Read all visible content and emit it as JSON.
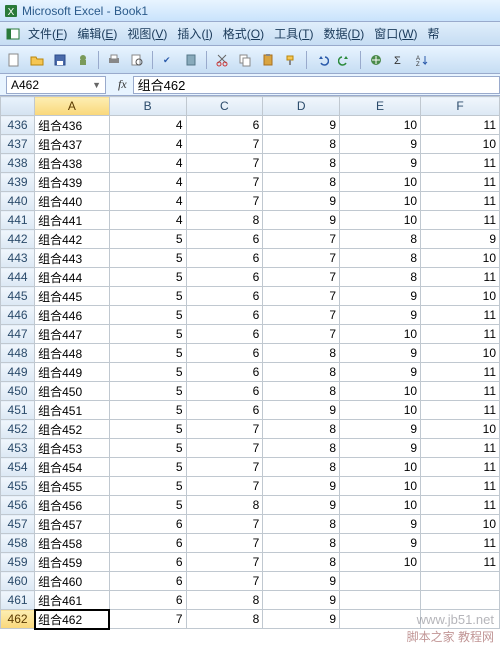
{
  "title": "Microsoft Excel - Book1",
  "menu": {
    "file": "文件",
    "file_k": "F",
    "edit": "编辑",
    "edit_k": "E",
    "view": "视图",
    "view_k": "V",
    "insert": "插入",
    "insert_k": "I",
    "format": "格式",
    "format_k": "O",
    "tools": "工具",
    "tools_k": "T",
    "data": "数据",
    "data_k": "D",
    "window": "窗口",
    "window_k": "W",
    "help": "帮"
  },
  "namebox": "A462",
  "fx_label": "fx",
  "formula": "组合462",
  "columns": [
    "A",
    "B",
    "C",
    "D",
    "E",
    "F"
  ],
  "selected_row": "462",
  "selected_col": "A",
  "rows": [
    {
      "n": "436",
      "a": "组合436",
      "b": "4",
      "c": "6",
      "d": "9",
      "e": "10",
      "f": "11"
    },
    {
      "n": "437",
      "a": "组合437",
      "b": "4",
      "c": "7",
      "d": "8",
      "e": "9",
      "f": "10"
    },
    {
      "n": "438",
      "a": "组合438",
      "b": "4",
      "c": "7",
      "d": "8",
      "e": "9",
      "f": "11"
    },
    {
      "n": "439",
      "a": "组合439",
      "b": "4",
      "c": "7",
      "d": "8",
      "e": "10",
      "f": "11"
    },
    {
      "n": "440",
      "a": "组合440",
      "b": "4",
      "c": "7",
      "d": "9",
      "e": "10",
      "f": "11"
    },
    {
      "n": "441",
      "a": "组合441",
      "b": "4",
      "c": "8",
      "d": "9",
      "e": "10",
      "f": "11"
    },
    {
      "n": "442",
      "a": "组合442",
      "b": "5",
      "c": "6",
      "d": "7",
      "e": "8",
      "f": "9"
    },
    {
      "n": "443",
      "a": "组合443",
      "b": "5",
      "c": "6",
      "d": "7",
      "e": "8",
      "f": "10"
    },
    {
      "n": "444",
      "a": "组合444",
      "b": "5",
      "c": "6",
      "d": "7",
      "e": "8",
      "f": "11"
    },
    {
      "n": "445",
      "a": "组合445",
      "b": "5",
      "c": "6",
      "d": "7",
      "e": "9",
      "f": "10"
    },
    {
      "n": "446",
      "a": "组合446",
      "b": "5",
      "c": "6",
      "d": "7",
      "e": "9",
      "f": "11"
    },
    {
      "n": "447",
      "a": "组合447",
      "b": "5",
      "c": "6",
      "d": "7",
      "e": "10",
      "f": "11"
    },
    {
      "n": "448",
      "a": "组合448",
      "b": "5",
      "c": "6",
      "d": "8",
      "e": "9",
      "f": "10"
    },
    {
      "n": "449",
      "a": "组合449",
      "b": "5",
      "c": "6",
      "d": "8",
      "e": "9",
      "f": "11"
    },
    {
      "n": "450",
      "a": "组合450",
      "b": "5",
      "c": "6",
      "d": "8",
      "e": "10",
      "f": "11"
    },
    {
      "n": "451",
      "a": "组合451",
      "b": "5",
      "c": "6",
      "d": "9",
      "e": "10",
      "f": "11"
    },
    {
      "n": "452",
      "a": "组合452",
      "b": "5",
      "c": "7",
      "d": "8",
      "e": "9",
      "f": "10"
    },
    {
      "n": "453",
      "a": "组合453",
      "b": "5",
      "c": "7",
      "d": "8",
      "e": "9",
      "f": "11"
    },
    {
      "n": "454",
      "a": "组合454",
      "b": "5",
      "c": "7",
      "d": "8",
      "e": "10",
      "f": "11"
    },
    {
      "n": "455",
      "a": "组合455",
      "b": "5",
      "c": "7",
      "d": "9",
      "e": "10",
      "f": "11"
    },
    {
      "n": "456",
      "a": "组合456",
      "b": "5",
      "c": "8",
      "d": "9",
      "e": "10",
      "f": "11"
    },
    {
      "n": "457",
      "a": "组合457",
      "b": "6",
      "c": "7",
      "d": "8",
      "e": "9",
      "f": "10"
    },
    {
      "n": "458",
      "a": "组合458",
      "b": "6",
      "c": "7",
      "d": "8",
      "e": "9",
      "f": "11"
    },
    {
      "n": "459",
      "a": "组合459",
      "b": "6",
      "c": "7",
      "d": "8",
      "e": "10",
      "f": "11"
    },
    {
      "n": "460",
      "a": "组合460",
      "b": "6",
      "c": "7",
      "d": "9",
      "e": "",
      "f": ""
    },
    {
      "n": "461",
      "a": "组合461",
      "b": "6",
      "c": "8",
      "d": "9",
      "e": "",
      "f": ""
    },
    {
      "n": "462",
      "a": "组合462",
      "b": "7",
      "c": "8",
      "d": "9",
      "e": "",
      "f": ""
    }
  ],
  "watermark1": "www.jb51.net",
  "watermark2": "脚本之家 教程网"
}
